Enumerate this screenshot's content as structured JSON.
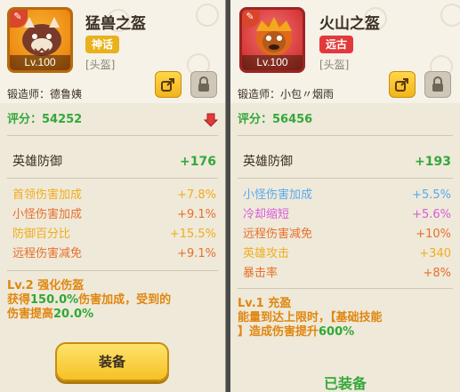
{
  "left": {
    "name": "猛兽之盔",
    "rarity": "神话",
    "level": "Lv.100",
    "slot": "[头盔]",
    "smith_label": "锻造师：德鲁姨",
    "score": "评分：54252",
    "main_stat": {
      "label": "英雄防御",
      "value": "+176"
    },
    "stats": [
      {
        "label": "首领伤害加成",
        "value": "+7.8%",
        "color": "#f0ad1c"
      },
      {
        "label": "小怪伤害加成",
        "value": "+9.1%",
        "color": "#e6702a"
      },
      {
        "label": "防御百分比",
        "value": "+15.5%",
        "color": "#f0ad1c"
      },
      {
        "label": "远程伤害减免",
        "value": "+9.1%",
        "color": "#e6702a"
      }
    ],
    "skill_title": "Lv.2 强化伤盔",
    "skill_desc_1a": "获得",
    "skill_desc_1b": "150.0%",
    "skill_desc_1c": "伤害加成，受到的",
    "skill_desc_2a": "伤害提高",
    "skill_desc_2b": "20.0%",
    "equip_button": "装备"
  },
  "right": {
    "name": "火山之盔",
    "rarity": "远古",
    "level": "Lv.100",
    "slot": "[头盔]",
    "smith_label": "锻造师：小包〃烟雨",
    "score": "评分：56456",
    "main_stat": {
      "label": "英雄防御",
      "value": "+193"
    },
    "stats": [
      {
        "label": "小怪伤害加成",
        "value": "+5.5%",
        "color": "#5aa9ee"
      },
      {
        "label": "冷却缩短",
        "value": "+5.6%",
        "color": "#d65cd9"
      },
      {
        "label": "远程伤害减免",
        "value": "+10%",
        "color": "#e6702a"
      },
      {
        "label": "英雄攻击",
        "value": "+340",
        "color": "#f0ad1c"
      },
      {
        "label": "暴击率",
        "value": "+8%",
        "color": "#e6702a"
      }
    ],
    "skill_title": "Lv.1 充盈",
    "skill_desc_1": "能量到达上限时，【基础技能",
    "skill_desc_2a": "】造成伤害提升",
    "skill_desc_2b": "600%",
    "equipped_label": "已装备"
  },
  "colors": {
    "score_green": "#33a83a",
    "orange": "#e0860f",
    "mythic": "#e9b21c",
    "ancient": "#e23a3a"
  }
}
